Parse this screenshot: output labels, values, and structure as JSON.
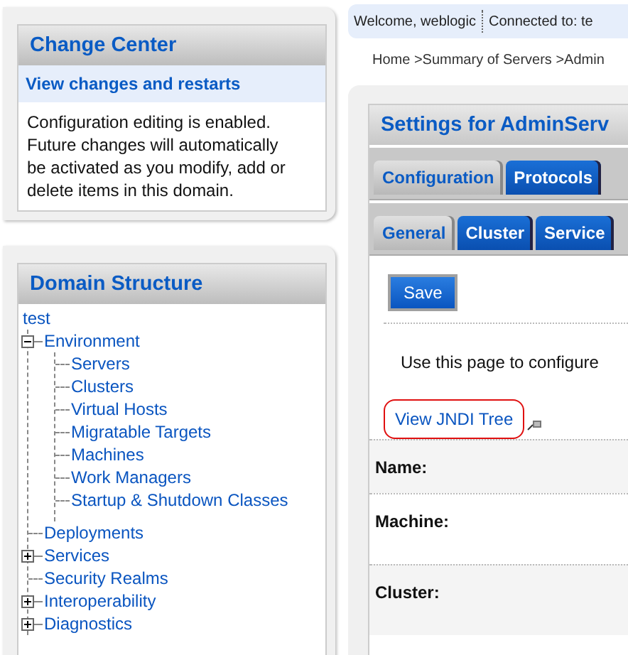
{
  "change_center": {
    "title": "Change Center",
    "link": "View changes and restarts",
    "message": "Configuration editing is enabled. Future changes will automatically be activated as you modify, add or delete items in this domain."
  },
  "domain_structure": {
    "title": "Domain Structure",
    "root": "test",
    "children": [
      {
        "label": "Environment",
        "kind": "folder",
        "expanded": true,
        "children": [
          {
            "label": "Servers"
          },
          {
            "label": "Clusters"
          },
          {
            "label": "Virtual Hosts"
          },
          {
            "label": "Migratable Targets"
          },
          {
            "label": "Machines"
          },
          {
            "label": "Work Managers"
          },
          {
            "label": "Startup & Shutdown Classes"
          }
        ]
      },
      {
        "label": "Deployments",
        "kind": "leaf"
      },
      {
        "label": "Services",
        "kind": "folder",
        "expanded": false
      },
      {
        "label": "Security Realms",
        "kind": "leaf"
      },
      {
        "label": "Interoperability",
        "kind": "folder",
        "expanded": false
      },
      {
        "label": "Diagnostics",
        "kind": "folder",
        "expanded": false
      }
    ]
  },
  "header": {
    "welcome": "Welcome, weblogic",
    "connected": "Connected to: te"
  },
  "breadcrumb": "Home >Summary of Servers >Admin",
  "settings": {
    "title": "Settings for AdminServ",
    "tabs": [
      {
        "label": "Configuration",
        "selected": true
      },
      {
        "label": "Protocols",
        "selected": false
      }
    ],
    "subtabs": [
      {
        "label": "General",
        "selected": true
      },
      {
        "label": "Cluster",
        "selected": false
      },
      {
        "label": "Service",
        "selected": false
      }
    ],
    "save_button": "Save",
    "description": "Use this page to configure",
    "jndi_link": "View JNDI Tree",
    "fields": [
      {
        "label": "Name:"
      },
      {
        "label": "Machine:"
      },
      {
        "label": "Cluster:"
      }
    ]
  }
}
